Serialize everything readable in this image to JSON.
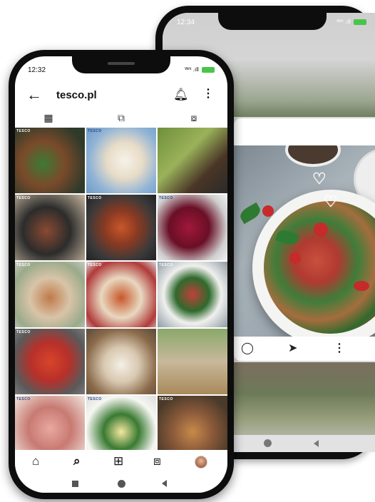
{
  "back_phone": {
    "status_time": "12:34",
    "status_icons": "ᵂᶦᶠᶦ .ıll",
    "post_actions": [
      "comment-icon",
      "share-icon",
      "more-icon"
    ]
  },
  "front_phone": {
    "status_time": "12:32",
    "status_icons": "ᵂᶦᶠᶦ .ıll",
    "header": {
      "title": "tesco.pl",
      "back_icon": "←",
      "bell_icon": "🔔",
      "more_icon": "⋮"
    },
    "tabs": [
      {
        "icon": "grid-icon",
        "glyph": "▦"
      },
      {
        "icon": "reels-icon",
        "glyph": "⧉"
      },
      {
        "icon": "tagged-icon",
        "glyph": "⧇"
      }
    ],
    "grid_tag": "TESCO",
    "bottom_nav": [
      {
        "icon": "home-icon",
        "glyph": "⌂"
      },
      {
        "icon": "search-icon",
        "glyph": "⌕"
      },
      {
        "icon": "add-post-icon",
        "glyph": "⊞"
      },
      {
        "icon": "shop-icon",
        "glyph": "⧈"
      }
    ]
  },
  "colors": {
    "battery": "#49c54a",
    "phone_frame": "#0d0d0d"
  }
}
